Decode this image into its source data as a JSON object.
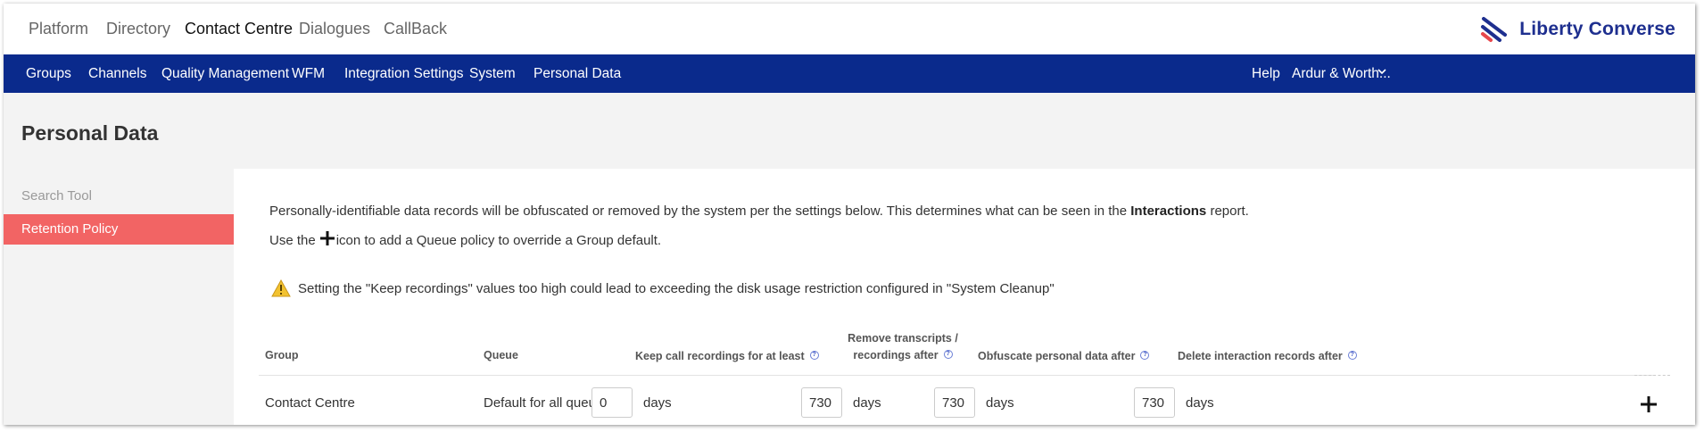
{
  "top_nav": {
    "tabs": [
      "Platform",
      "Directory",
      "Contact Centre",
      "Dialogues",
      "CallBack"
    ],
    "active_tab": "Contact Centre"
  },
  "logo": {
    "text": "Liberty Converse"
  },
  "menu": {
    "items": [
      "Groups",
      "Channels",
      "Quality Management",
      "WFM",
      "Integration Settings",
      "System",
      "Personal Data"
    ],
    "help": "Help",
    "user": "Ardur & Worth..."
  },
  "page": {
    "title": "Personal Data"
  },
  "side_nav": {
    "search_tool": "Search Tool",
    "retention_policy": "Retention Policy"
  },
  "content": {
    "intro_before": "Personally-identifiable data records will be obfuscated or removed by the system per the settings below. This determines what can be seen in the",
    "intro_bold": "Interactions",
    "intro_after": "report.",
    "add_before": "Use the",
    "add_after": "icon to add a Queue policy to override a Group default.",
    "warning": "Setting the \"Keep recordings\" values too high could lead to exceeding the disk usage restriction configured in \"System Cleanup\""
  },
  "table": {
    "headers": {
      "group": "Group",
      "queue": "Queue",
      "keep": "Keep call recordings for at least",
      "remove_line1": "Remove transcripts /",
      "remove_line2": "recordings after",
      "obfuscate": "Obfuscate personal data after",
      "delete": "Delete interaction records after"
    },
    "rows": [
      {
        "group": "Contact Centre",
        "queue": "Default for all queues",
        "keep": "0",
        "remove": "730",
        "obfuscate": "730",
        "delete": "730",
        "unit": "days"
      }
    ]
  },
  "colors": {
    "menu_bar": "#0a2a8c",
    "active_side": "#f26464",
    "brand": "#1e2f8f",
    "logo_accent": "#e8474c"
  },
  "icons": {
    "add": "plus-icon",
    "warning": "warning-icon",
    "help": "help-icon",
    "dropdown": "chevron-down-icon"
  }
}
